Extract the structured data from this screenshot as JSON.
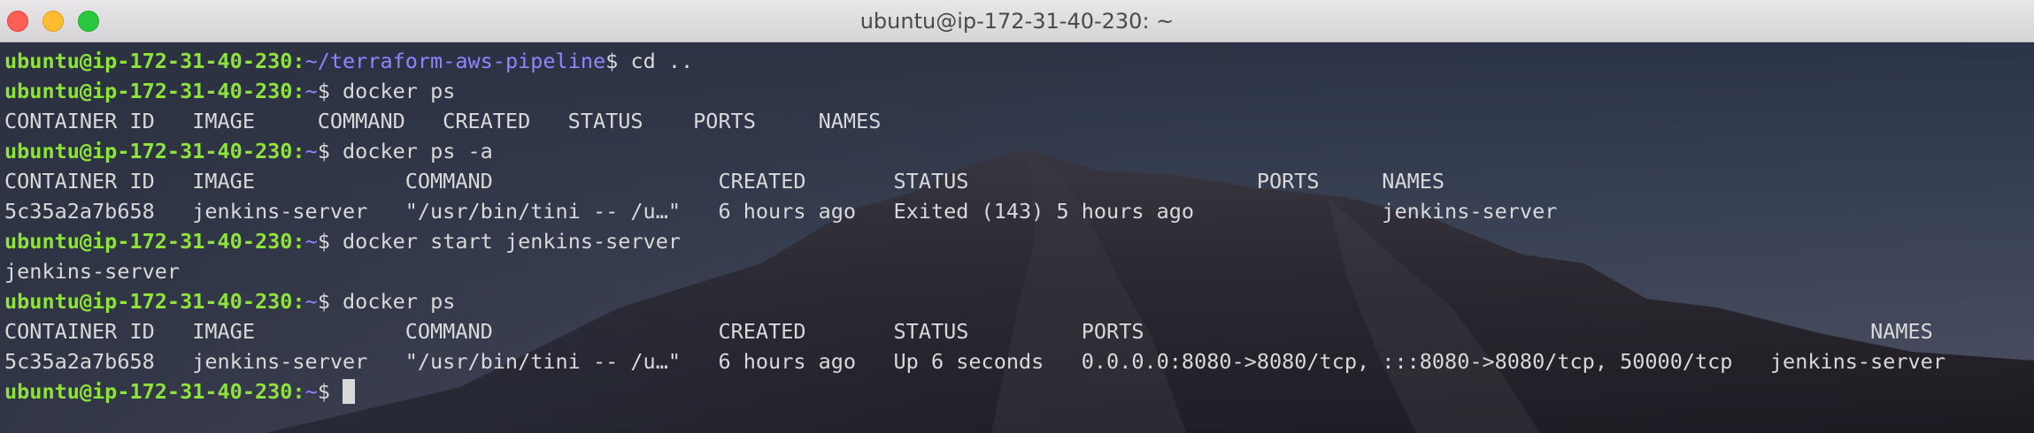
{
  "window": {
    "title": "ubuntu@ip-172-31-40-230: ~"
  },
  "terminal": {
    "prompt_user": "ubuntu@ip-172-31-40-230",
    "lines": [
      {
        "kind": "prompt",
        "path": "~/terraform-aws-pipeline",
        "command": "cd .."
      },
      {
        "kind": "prompt",
        "path": "~",
        "command": "docker ps"
      },
      {
        "kind": "output",
        "text": "CONTAINER ID   IMAGE     COMMAND   CREATED   STATUS    PORTS     NAMES"
      },
      {
        "kind": "prompt",
        "path": "~",
        "command": "docker ps -a"
      },
      {
        "kind": "output",
        "text": "CONTAINER ID   IMAGE            COMMAND                  CREATED       STATUS                       PORTS     NAMES"
      },
      {
        "kind": "output",
        "text": "5c35a2a7b658   jenkins-server   \"/usr/bin/tini -- /u…\"   6 hours ago   Exited (143) 5 hours ago               jenkins-server"
      },
      {
        "kind": "prompt",
        "path": "~",
        "command": "docker start jenkins-server"
      },
      {
        "kind": "output",
        "text": "jenkins-server"
      },
      {
        "kind": "prompt",
        "path": "~",
        "command": "docker ps"
      },
      {
        "kind": "output",
        "text": "CONTAINER ID   IMAGE            COMMAND                  CREATED       STATUS         PORTS                                                          NAMES"
      },
      {
        "kind": "output",
        "text": "5c35a2a7b658   jenkins-server   \"/usr/bin/tini -- /u…\"   6 hours ago   Up 6 seconds   0.0.0.0:8080->8080/tcp, :::8080->8080/tcp, 50000/tcp   jenkins-server"
      },
      {
        "kind": "prompt",
        "path": "~",
        "command": "",
        "cursor": true
      }
    ]
  },
  "colors": {
    "prompt_user": "#8ee33a",
    "prompt_path": "#8f86ff",
    "text": "#d9d9d9"
  },
  "icons": [
    "close-icon",
    "minimize-icon",
    "zoom-icon"
  ]
}
